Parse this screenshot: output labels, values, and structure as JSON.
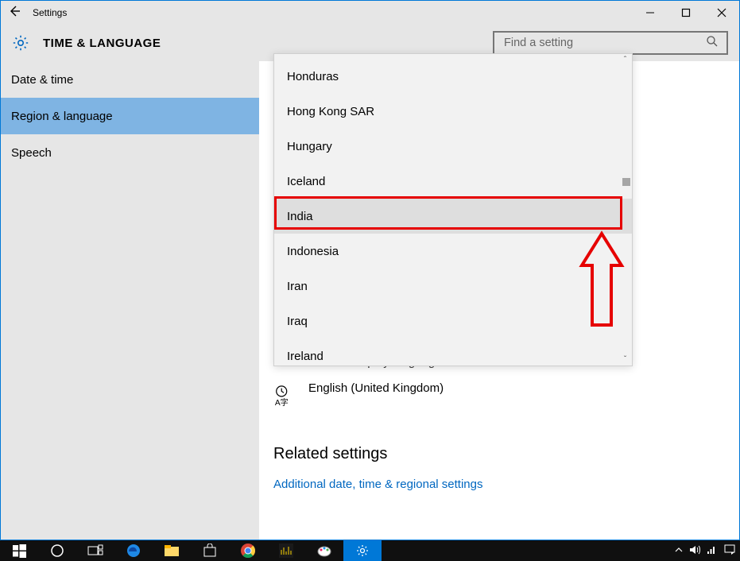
{
  "window": {
    "title": "Settings"
  },
  "header": {
    "page_title": "TIME & LANGUAGE",
    "search_placeholder": "Find a setting"
  },
  "sidebar": {
    "items": [
      {
        "label": "Date & time"
      },
      {
        "label": "Region & language"
      },
      {
        "label": "Speech"
      }
    ],
    "selected_index": 1
  },
  "dropdown": {
    "items": [
      "Honduras",
      "Hong Kong SAR",
      "Hungary",
      "Iceland",
      "India",
      "Indonesia",
      "Iran",
      "Iraq",
      "Ireland"
    ],
    "hover_index": 4
  },
  "main": {
    "partial_line": "Windows display language",
    "language_row": "English (United Kingdom)",
    "related_heading": "Related settings",
    "related_link": "Additional date, time & regional settings"
  },
  "annotation": {
    "highlight_item": "India"
  }
}
